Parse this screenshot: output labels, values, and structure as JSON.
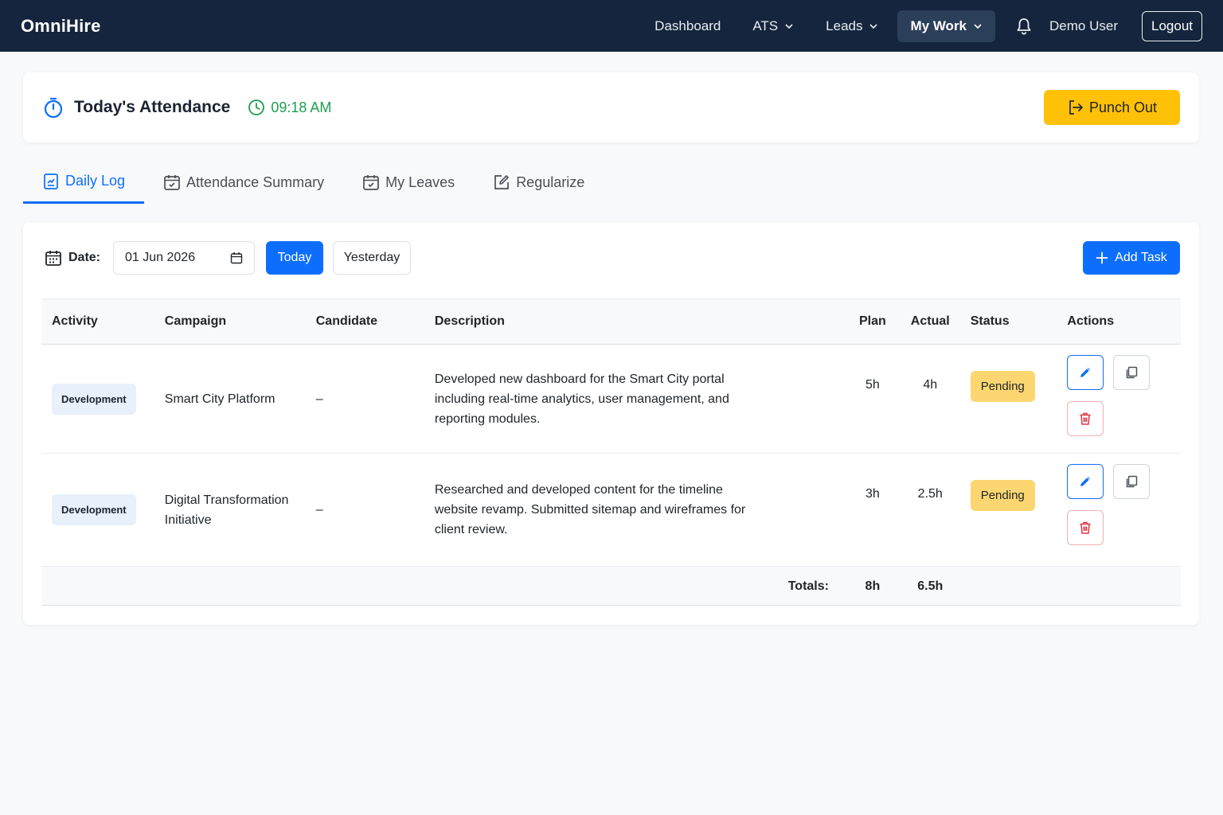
{
  "navbar": {
    "brand": "OmniHire",
    "links": [
      {
        "label": "Dashboard"
      },
      {
        "label": "ATS"
      },
      {
        "label": "Leads"
      },
      {
        "label": "My Work"
      }
    ],
    "user": "Demo User",
    "logout": "Logout"
  },
  "attendance": {
    "title": "Today's Attendance",
    "time": "09:18 AM",
    "punch_label": "Punch Out"
  },
  "tabs": [
    {
      "label": "Daily Log"
    },
    {
      "label": "Attendance Summary"
    },
    {
      "label": "My Leaves"
    },
    {
      "label": "Regularize"
    }
  ],
  "filters": {
    "date_label": "Date:",
    "date_value": "01 Jun 2026",
    "today": "Today",
    "yesterday": "Yesterday",
    "add_task": "Add Task"
  },
  "table": {
    "headers": {
      "activity": "Activity",
      "campaign": "Campaign",
      "candidate": "Candidate",
      "description": "Description",
      "plan": "Plan",
      "actual": "Actual",
      "status": "Status",
      "actions": "Actions"
    },
    "rows": [
      {
        "activity": "Development",
        "campaign": "Smart City Platform",
        "candidate": "–",
        "description": "Developed new dashboard for the Smart City portal including real-time analytics, user management, and reporting modules.",
        "plan": "5h",
        "actual": "4h",
        "status": "Pending"
      },
      {
        "activity": "Development",
        "campaign": "Digital Transformation Initiative",
        "candidate": "–",
        "description": "Researched and developed content for the timeline website revamp. Submitted sitemap and wireframes for client review.",
        "plan": "3h",
        "actual": "2.5h",
        "status": "Pending"
      }
    ],
    "totals": {
      "label": "Totals:",
      "plan": "8h",
      "actual": "6.5h"
    }
  },
  "colors": {
    "navbar_bg": "#14253d",
    "primary": "#0d6efd",
    "warning": "#ffc107",
    "success": "#1e9e4f",
    "danger": "#dc3545"
  }
}
